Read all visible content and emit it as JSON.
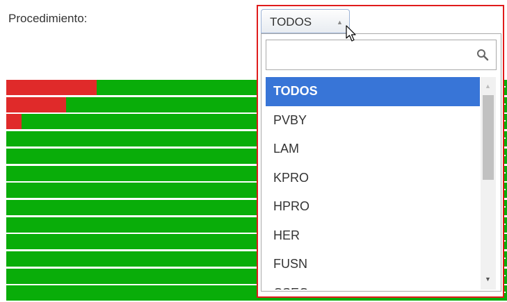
{
  "filter": {
    "label": "Procedimiento:",
    "selected_value": "TODOS"
  },
  "dropdown": {
    "search_value": "",
    "options": [
      "TODOS",
      "PVBY",
      "LAM",
      "KPRO",
      "HPRO",
      "HER",
      "FUSN",
      "CSEC"
    ],
    "selected_index": 0
  },
  "chart_data": {
    "type": "bar",
    "orientation": "horizontal",
    "stacked": true,
    "note_visibility": "partially obscured by dropdown",
    "series": [
      {
        "color": "#e02a2a",
        "values": [
          0.18,
          0.12,
          0.03,
          0,
          0,
          0,
          0,
          0,
          0,
          0,
          0,
          0,
          0
        ]
      },
      {
        "color": "#09ad09",
        "values": [
          0.82,
          0.88,
          0.97,
          1,
          1,
          1,
          1,
          1,
          1,
          1,
          1,
          1,
          1
        ]
      }
    ]
  },
  "colors": {
    "highlight_border": "#e01b1b",
    "selected_option_bg": "#3875d7",
    "bar_green": "#09ad09",
    "bar_red": "#e02a2a"
  }
}
